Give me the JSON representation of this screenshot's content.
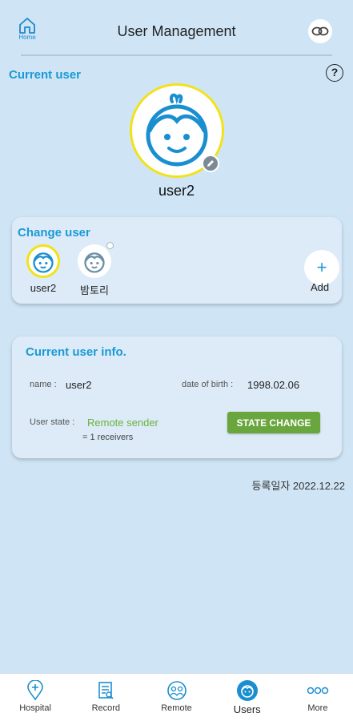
{
  "header": {
    "home_label": "Home",
    "title": "User Management"
  },
  "current_user": {
    "section_title": "Current user",
    "help_label": "?",
    "name": "user2"
  },
  "change_user": {
    "section_title": "Change user",
    "users": [
      {
        "name": "user2",
        "selected": true
      },
      {
        "name": "밤토리",
        "selected": false
      }
    ],
    "add_label": "Add"
  },
  "info": {
    "section_title": "Current user info.",
    "name_label": "name :",
    "name_value": "user2",
    "dob_label": "date of birth :",
    "dob_value": "1998.02.06",
    "state_label": "User state :",
    "state_value": "Remote sender",
    "receivers": "= 1 receivers",
    "state_button": "STATE CHANGE"
  },
  "registration_date": "등록일자 2022.12.22",
  "nav": [
    {
      "label": "Hospital",
      "icon": "hospital-pin-icon"
    },
    {
      "label": "Record",
      "icon": "record-icon"
    },
    {
      "label": "Remote",
      "icon": "remote-users-icon"
    },
    {
      "label": "Users",
      "icon": "users-icon",
      "active": true
    },
    {
      "label": "More",
      "icon": "more-icon"
    }
  ],
  "colors": {
    "background": "#cfe5f6",
    "accent": "#1a9ad6",
    "selected_ring": "#f2e21a",
    "green": "#6aa63e"
  }
}
